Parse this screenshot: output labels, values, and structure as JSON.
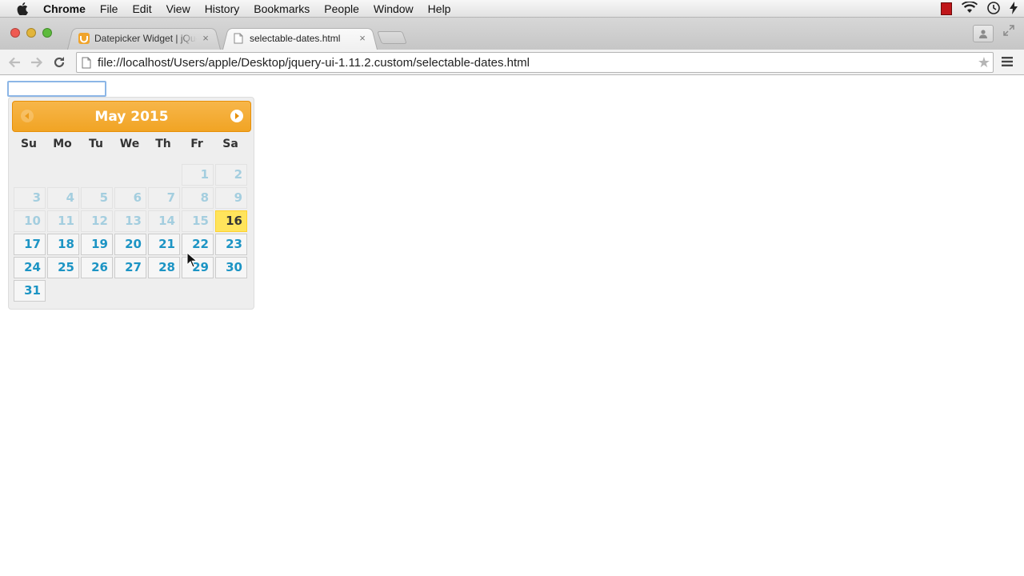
{
  "menubar": {
    "app": "Chrome",
    "items": [
      "File",
      "Edit",
      "View",
      "History",
      "Bookmarks",
      "People",
      "Window",
      "Help"
    ]
  },
  "tabs": [
    {
      "title": "Datepicker Widget | jQuery",
      "close": "×",
      "state": "inactive",
      "favicon": "jquery-icon"
    },
    {
      "title": "selectable-dates.html",
      "close": "×",
      "state": "active",
      "favicon": "page-icon"
    }
  ],
  "address_bar": {
    "url": "file://localhost/Users/apple/Desktop/jquery-ui-1.11.2.custom/selectable-dates.html",
    "star": "★"
  },
  "page": {
    "date_input": {
      "value": "",
      "placeholder": ""
    }
  },
  "datepicker": {
    "title": "May 2015",
    "weekdays": [
      "Su",
      "Mo",
      "Tu",
      "We",
      "Th",
      "Fr",
      "Sa"
    ],
    "weeks": [
      [
        null,
        null,
        null,
        null,
        null,
        {
          "d": "1",
          "s": "disabled"
        },
        {
          "d": "2",
          "s": "disabled"
        }
      ],
      [
        {
          "d": "3",
          "s": "disabled"
        },
        {
          "d": "4",
          "s": "disabled"
        },
        {
          "d": "5",
          "s": "disabled"
        },
        {
          "d": "6",
          "s": "disabled"
        },
        {
          "d": "7",
          "s": "disabled"
        },
        {
          "d": "8",
          "s": "disabled"
        },
        {
          "d": "9",
          "s": "disabled"
        }
      ],
      [
        {
          "d": "10",
          "s": "disabled"
        },
        {
          "d": "11",
          "s": "disabled"
        },
        {
          "d": "12",
          "s": "disabled"
        },
        {
          "d": "13",
          "s": "disabled"
        },
        {
          "d": "14",
          "s": "disabled"
        },
        {
          "d": "15",
          "s": "disabled"
        },
        {
          "d": "16",
          "s": "today"
        }
      ],
      [
        {
          "d": "17",
          "s": "enabled"
        },
        {
          "d": "18",
          "s": "enabled"
        },
        {
          "d": "19",
          "s": "enabled"
        },
        {
          "d": "20",
          "s": "enabled"
        },
        {
          "d": "21",
          "s": "enabled"
        },
        {
          "d": "22",
          "s": "enabled"
        },
        {
          "d": "23",
          "s": "enabled"
        }
      ],
      [
        {
          "d": "24",
          "s": "enabled"
        },
        {
          "d": "25",
          "s": "enabled"
        },
        {
          "d": "26",
          "s": "enabled"
        },
        {
          "d": "27",
          "s": "enabled"
        },
        {
          "d": "28",
          "s": "enabled"
        },
        {
          "d": "29",
          "s": "enabled"
        },
        {
          "d": "30",
          "s": "enabled"
        }
      ],
      [
        {
          "d": "31",
          "s": "enabled"
        },
        null,
        null,
        null,
        null,
        null,
        null
      ]
    ]
  },
  "colors": {
    "header": "#f1a424",
    "day_link": "#1c94c4",
    "today_bg": "#ffe45c"
  }
}
